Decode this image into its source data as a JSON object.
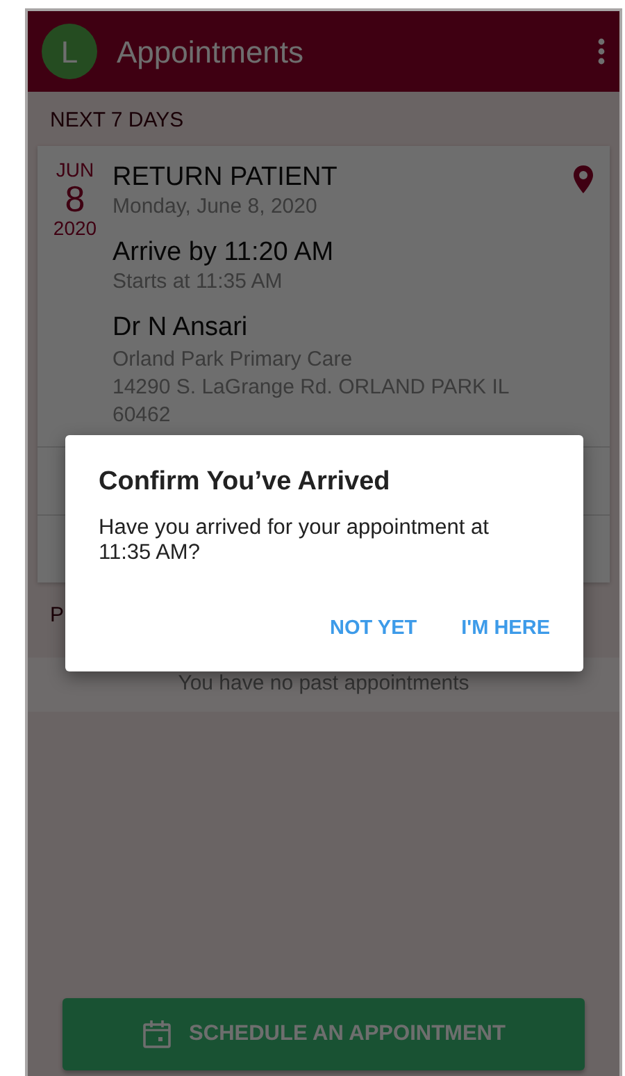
{
  "app_bar": {
    "avatar": "L",
    "title": "Appointments"
  },
  "upcoming": {
    "heading": "NEXT 7 DAYS",
    "appointments": [
      {
        "month": "JUN",
        "day": "8",
        "year": "2020",
        "type": "RETURN PATIENT",
        "date": "Monday, June 8, 2020",
        "arrive": "Arrive by 11:20 AM",
        "starts": "Starts at 11:35 AM",
        "provider": "Dr N Ansari",
        "location": "Orland Park Primary Care",
        "address_lines": [
          "14290 S. LaGrange Rd. ORLAND PARK IL",
          "60462"
        ]
      }
    ]
  },
  "past": {
    "heading": "P",
    "empty_message": "You have no past appointments"
  },
  "schedule_button": "SCHEDULE AN APPOINTMENT",
  "dialog": {
    "title": "Confirm You’ve Arrived",
    "message": "Have you arrived for your appointment at 11:35 AM?",
    "actions": [
      "NOT YET",
      "I'M HERE"
    ]
  }
}
